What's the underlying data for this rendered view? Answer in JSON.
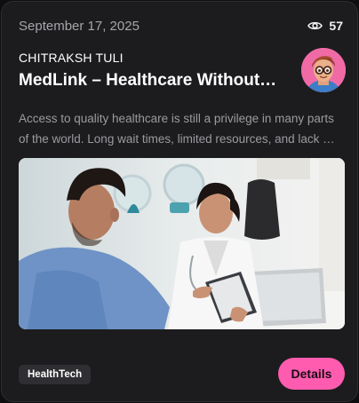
{
  "post": {
    "date": "September 17, 2025",
    "views": "57",
    "author": "CHITRAKSH TULI",
    "title": "MedLink – Healthcare Without…",
    "excerpt": "Access to quality healthcare is still a privilege in many parts of the world. Long wait times, limited resources, and lack …",
    "tag": "HealthTech",
    "details_label": "Details"
  },
  "icons": {
    "views": "eye-icon"
  },
  "colors": {
    "card_background": "#1c1c1e",
    "accent_button": "#ff5cb0",
    "tag_background": "#2f2f33",
    "muted_text": "#9b9ba0"
  }
}
